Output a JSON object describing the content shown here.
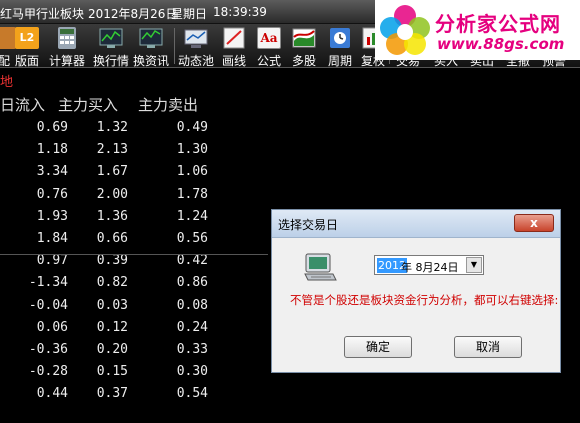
{
  "titlebar": {
    "name": "红马甲行业板块",
    "date": "2012年8月26日",
    "weekday": "星期日",
    "time": "18:39:39"
  },
  "watermark": {
    "cn": "分析家公式网",
    "url": "www.88gs.com"
  },
  "toolbar": {
    "items": [
      {
        "label": "配",
        "icon": "app-icon"
      },
      {
        "label": "版面",
        "icon": "layout-l2-icon"
      },
      {
        "label": "计算器",
        "icon": "calculator-icon"
      },
      {
        "label": "换行情",
        "icon": "quotes-switch-icon"
      },
      {
        "label": "换资讯",
        "icon": "news-switch-icon"
      },
      {
        "label": "动态池",
        "icon": "dynamic-pool-icon"
      },
      {
        "label": "画线",
        "icon": "draw-line-icon"
      },
      {
        "label": "公式",
        "icon": "formula-icon"
      },
      {
        "label": "多股",
        "icon": "multi-stock-icon"
      },
      {
        "label": "周期",
        "icon": "period-icon"
      },
      {
        "label": "复权",
        "icon": "adjust-icon"
      },
      {
        "label": "交易",
        "icon": "trade-icon"
      },
      {
        "label": "买入",
        "icon": "buy-icon"
      },
      {
        "label": "卖出",
        "icon": "sell-icon"
      },
      {
        "label": "全撤",
        "icon": "cancel-all-icon"
      },
      {
        "label": "预警",
        "icon": "alert-icon"
      }
    ]
  },
  "subrow": {
    "text": "地"
  },
  "table": {
    "headers": [
      "日流入",
      "主力买入",
      "主力卖出"
    ],
    "rows": [
      [
        "0.69",
        "1.32",
        "0.49"
      ],
      [
        "1.18",
        "2.13",
        "1.30"
      ],
      [
        "3.34",
        "1.67",
        "1.06"
      ],
      [
        "0.76",
        "2.00",
        "1.78"
      ],
      [
        "1.93",
        "1.36",
        "1.24"
      ],
      [
        "1.84",
        "0.66",
        "0.56"
      ],
      [
        "0.97",
        "0.39",
        "0.42"
      ],
      [
        "-1.34",
        "0.82",
        "0.86"
      ],
      [
        "-0.04",
        "0.03",
        "0.08"
      ],
      [
        "0.06",
        "0.12",
        "0.24"
      ],
      [
        "-0.36",
        "0.20",
        "0.33"
      ],
      [
        "-0.28",
        "0.15",
        "0.30"
      ],
      [
        "0.44",
        "0.37",
        "0.54"
      ]
    ]
  },
  "dialog": {
    "title": "选择交易日",
    "close": "x",
    "year": "2012",
    "date_rest": "年 8月24日",
    "dropdown_arrow": "▼",
    "hint": "不管是个股还是板块资金行为分析，都可以右键选择:",
    "ok": "确定",
    "cancel": "取消"
  },
  "colors": {
    "background": "#000000",
    "header_text": "#dddddd",
    "hint_red": "#d00000",
    "watermark_pink": "#e5007f"
  }
}
